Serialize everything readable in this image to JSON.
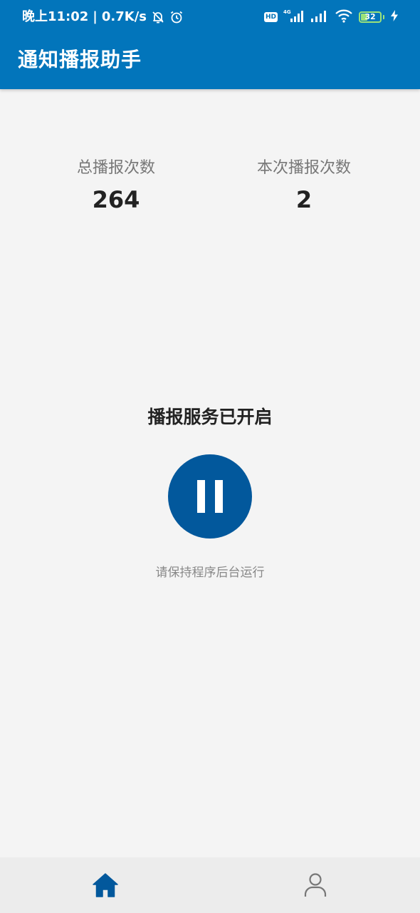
{
  "status_bar": {
    "time": "晚上11:02",
    "speed": "0.7K/s",
    "hd_label": "HD",
    "network_label": "4G",
    "battery_level": "32"
  },
  "app": {
    "title": "通知播报助手",
    "brand_color": "#0275bb",
    "accent_color": "#02589c"
  },
  "stats": {
    "total_label": "总播报次数",
    "total_value": "264",
    "current_label": "本次播报次数",
    "current_value": "2"
  },
  "service": {
    "status_text": "播报服务已开启",
    "toggle_icon": "pause-icon",
    "hint": "请保持程序后台运行"
  },
  "bottom_nav": {
    "items": [
      {
        "icon": "home-icon",
        "active": true
      },
      {
        "icon": "user-icon",
        "active": false
      }
    ]
  }
}
